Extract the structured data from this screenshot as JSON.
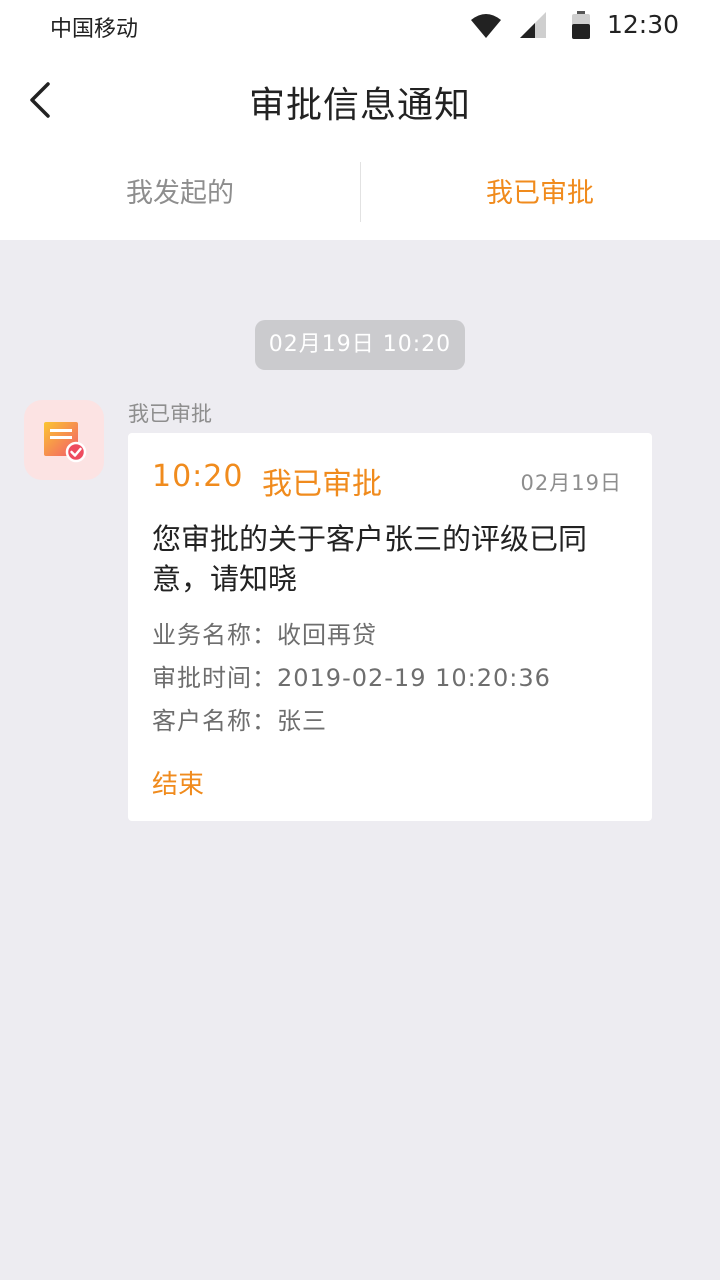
{
  "status_bar": {
    "carrier": "中国移动",
    "time": "12:30"
  },
  "nav": {
    "title": "审批信息通知"
  },
  "tabs": [
    {
      "label": "我发起的",
      "active": false
    },
    {
      "label": "我已审批",
      "active": true
    }
  ],
  "feed": {
    "timestamp": "02月19日 10:20",
    "sender": "我已审批",
    "card": {
      "time": "10:20",
      "status": "我已审批",
      "date": "02月19日",
      "message": "您审批的关于客户张三的评级已同意，请知晓",
      "fields": [
        "业务名称：收回再贷",
        "审批时间：2019-02-19 10:20:36",
        "客户名称：张三"
      ],
      "action": "结束"
    }
  },
  "colors": {
    "accent": "#F08B1D",
    "background": "#EDECF1",
    "pill": "#CBCBCE",
    "avatar_bg": "#FCE3E3"
  }
}
